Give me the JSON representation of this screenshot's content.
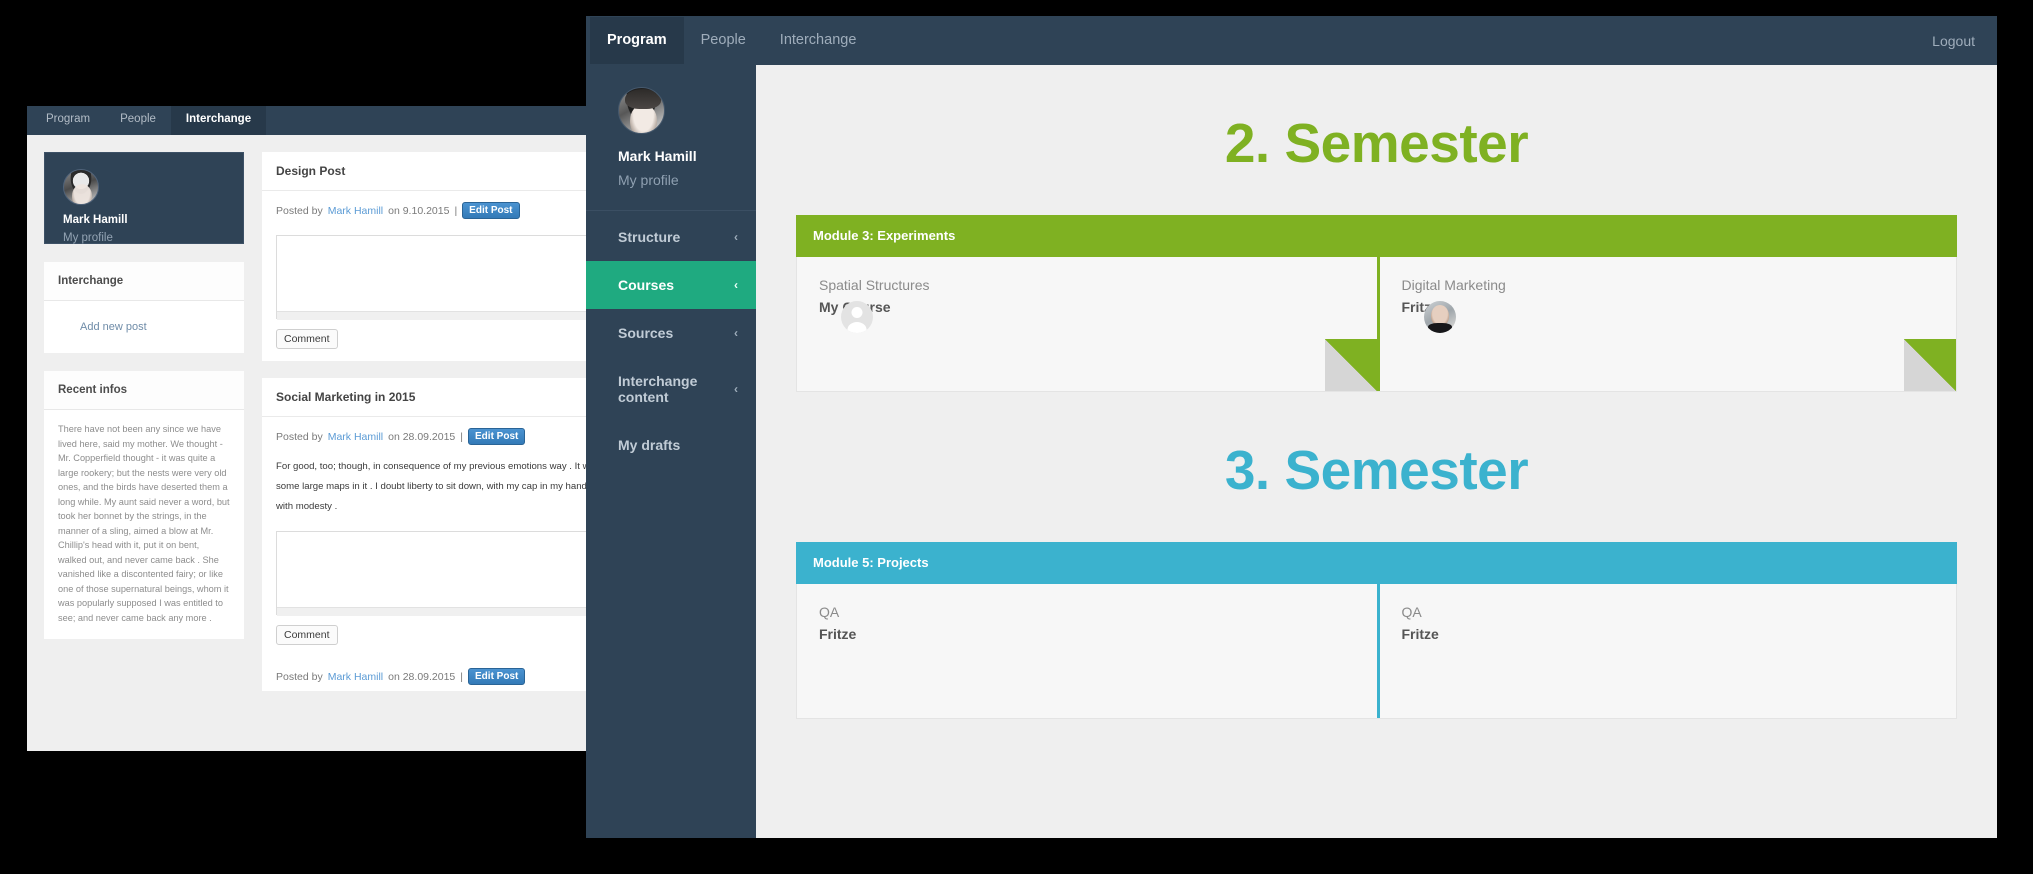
{
  "background_window": {
    "tabs": [
      {
        "label": "Program",
        "active": false
      },
      {
        "label": "People",
        "active": false
      },
      {
        "label": "Interchange",
        "active": true
      }
    ],
    "profile": {
      "name": "Mark Hamill",
      "sub": "My profile",
      "avatar_icon": "user-photo-avatar"
    },
    "panels": [
      {
        "title": "Interchange",
        "link": "Add new post"
      },
      {
        "title": "Recent infos",
        "body": "There have not been any since we have lived here, said my mother. We thought - Mr. Copperfield thought - it was quite a large rookery; but the nests were very old ones, and the birds have deserted them a long while. My aunt said never a word, but took her bonnet by the strings, in the manner of a sling, aimed a blow at Mr. Chillip's head with it, put it on bent, walked out, and never came back . She vanished like a discontented fairy; or like one of those supernatural beings, whom it was popularly supposed I was entitled to see; and never came back any more ."
      }
    ],
    "posts": [
      {
        "title": "Design Post",
        "meta_prefix": "Posted by",
        "author": "Mark Hamill",
        "meta_middle": "on 9.10.2015",
        "separator": "|",
        "edit_label": "Edit Post",
        "text": "",
        "comment_label": "Comment"
      },
      {
        "title": "Social Marketing in 2015",
        "meta_prefix": "Posted by",
        "author": "Mark Hamill",
        "meta_middle": "on 28.09.2015",
        "separator": "|",
        "edit_label": "Edit Post",
        "text": "For good, too; though, in consequence of my previous emotions way . It was a large long room with some large maps in it . I doubt liberty to sit down, with my cap in my hand, on the corner of the over with modesty .",
        "comment_label": "Comment"
      }
    ],
    "trailing_meta": {
      "meta_prefix": "Posted by",
      "author": "Mark Hamill",
      "meta_middle": "on 28.09.2015",
      "separator": "|",
      "edit_label": "Edit Post"
    }
  },
  "foreground_window": {
    "topbar": {
      "tabs": [
        {
          "label": "Program",
          "active": true
        },
        {
          "label": "People",
          "active": false
        },
        {
          "label": "Interchange",
          "active": false
        }
      ],
      "logout_label": "Logout"
    },
    "sidebar": {
      "profile": {
        "name": "Mark Hamill",
        "sub": "My profile",
        "avatar_icon": "user-photo-avatar"
      },
      "items": [
        {
          "label": "Structure",
          "chevron": "‹",
          "active": false
        },
        {
          "label": "Courses",
          "chevron": "‹",
          "active": true
        },
        {
          "label": "Sources",
          "chevron": "‹",
          "active": false
        },
        {
          "label": "Interchange content",
          "chevron": "‹",
          "active": false
        },
        {
          "label": "My drafts",
          "chevron": "",
          "active": false
        }
      ]
    },
    "sections": [
      {
        "title": "2. Semester",
        "accent": "#7fb122",
        "module_label": "Module 3: Experiments",
        "cards": [
          {
            "subject": "Spatial Structures",
            "teacher": "My Course",
            "avatar_icon": "user-placeholder-icon",
            "avatar_type": "placeholder"
          },
          {
            "subject": "Digital Marketing",
            "teacher": "Fritze",
            "avatar_icon": "teacher-photo-avatar",
            "avatar_type": "photo"
          }
        ],
        "show_corner": true
      },
      {
        "title": "3. Semester",
        "accent": "#3bb2ce",
        "module_label": "Module 5: Projects",
        "cards": [
          {
            "subject": "QA",
            "teacher": "Fritze",
            "avatar_icon": "",
            "avatar_type": "none"
          },
          {
            "subject": "QA",
            "teacher": "Fritze",
            "avatar_icon": "",
            "avatar_type": "none"
          }
        ],
        "show_corner": false
      }
    ]
  }
}
